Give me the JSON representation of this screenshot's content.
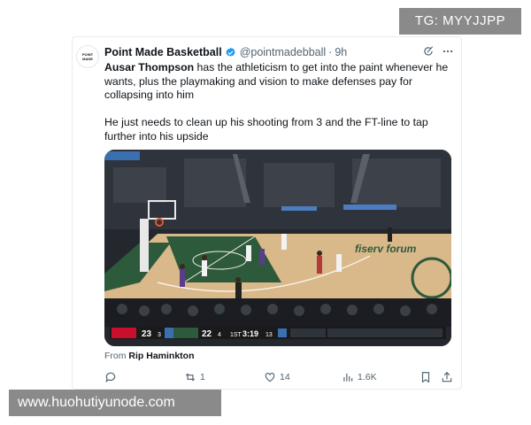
{
  "watermarks": {
    "top_right": "TG: MYYJJPP",
    "bottom_left": "www.huohutiyunode.com"
  },
  "tweet": {
    "avatar_text_line1": "POINT",
    "avatar_text_line2": "MADE",
    "display_name": "Point Made Basketball",
    "handle": "@pointmadebball",
    "separator": "·",
    "time": "9h",
    "paragraph1_mention": "Ausar Thompson",
    "paragraph1_rest": " has the athleticism to get into the paint whenever he wants, plus the playmaking and vision to make defenses pay for collapsing into him",
    "paragraph2": "He just needs to clean up his shooting from 3 and the FT-line to tap further into his upside",
    "from_prefix": "From ",
    "from_name": "Rip Haminkton",
    "actions": {
      "replies": "",
      "reposts": "1",
      "likes": "14",
      "views": "1.6K"
    }
  },
  "video": {
    "scoreboard_left_team_score": "23",
    "scoreboard_left_small": "3",
    "scoreboard_right_team_score": "22",
    "scoreboard_right_small": "4",
    "period": "1ST",
    "clock": "3:19",
    "shot_clock": "13",
    "arena_text": "fiserv forum",
    "colors": {
      "court_wood": "#d9b88a",
      "court_green": "#2e5a3c",
      "scoreboard_bg": "#1a1a1a"
    }
  },
  "icons": {
    "verified": "verified-badge-icon",
    "grok": "grok-icon",
    "more": "more-icon",
    "reply": "reply-icon",
    "repost": "repost-icon",
    "like": "like-icon",
    "views": "views-icon",
    "bookmark": "bookmark-icon",
    "share": "share-icon"
  }
}
